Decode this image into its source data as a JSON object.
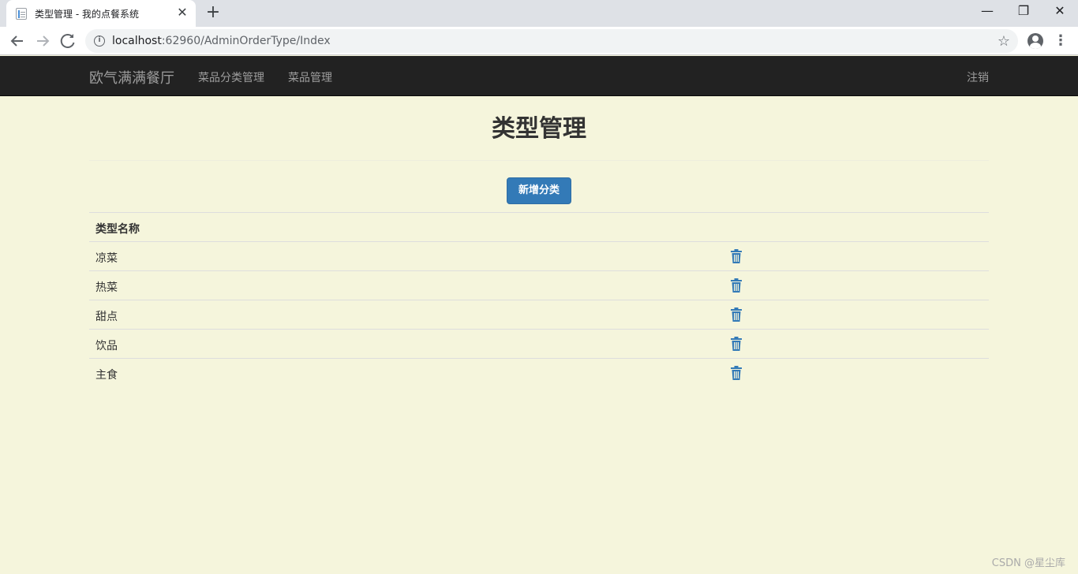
{
  "browser": {
    "tab_title": "类型管理 - 我的点餐系统",
    "tab_close": "✕",
    "new_tab": "+",
    "url_host": "localhost",
    "url_path": ":62960/AdminOrderType/Index",
    "window_controls": {
      "minimize": "—",
      "maximize": "❐",
      "close": "✕"
    },
    "icons": [
      "back-icon",
      "forward-icon",
      "reload-icon",
      "info-icon",
      "star-icon",
      "profile-icon",
      "menu-icon"
    ]
  },
  "navbar": {
    "brand": "欧气满满餐厅",
    "links": [
      "菜品分类管理",
      "菜品管理"
    ],
    "logout": "注销"
  },
  "page": {
    "title": "类型管理",
    "add_button": "新增分类"
  },
  "table": {
    "header": "类型名称",
    "rows": [
      "凉菜",
      "热菜",
      "甜点",
      "饮品",
      "主食"
    ],
    "row_action_icon": "trash-icon"
  },
  "watermark": "CSDN @星尘库",
  "colors": {
    "navbar_bg": "#222222",
    "page_bg": "#f5f5dc",
    "primary_button": "#337ab7",
    "icon_blue": "#337ab7"
  }
}
